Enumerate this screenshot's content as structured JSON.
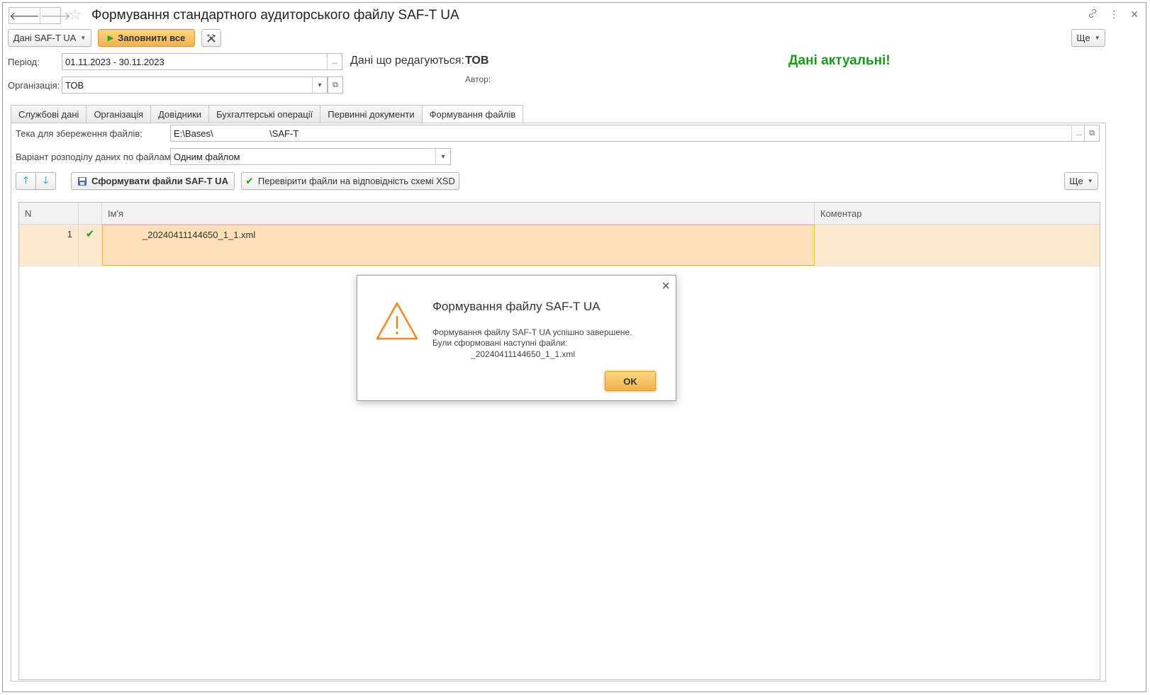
{
  "window": {
    "title": "Формування стандартного аудиторського файлу SAF-T UA",
    "nav": {
      "back": "🡐",
      "forward": "🡒"
    },
    "icons": {
      "link": "link-icon",
      "menu": "more-vertical-icon",
      "close": "close-icon"
    }
  },
  "toolbar": {
    "data_menu": "Дані SAF-T UA",
    "fill_all": "Заповнити все",
    "more": "Ще"
  },
  "header": {
    "period_label": "Період:",
    "period_value": "01.11.2023 - 30.11.2023",
    "period_btn": "...",
    "org_label": "Організація:",
    "org_value": "ТОВ",
    "edited_label": "Дані що редагуються:",
    "edited_value": "ТОВ",
    "author_label": "Автор:",
    "status": "Дані актуальні!",
    "status_color": "#1a9a1a"
  },
  "tabs": [
    "Службові дані",
    "Організація",
    "Довідники",
    "Бухгалтерські операції",
    "Первинні документи",
    "Формування файлів"
  ],
  "files_tab": {
    "folder_label": "Тека для збереження файлів:",
    "folder_value": "E:\\Bases\\                      \\SAF-T",
    "folder_btn": "...",
    "split_label": "Варіант розподілу даних по файлам:",
    "split_value": "Одним файлом",
    "generate_btn": "Сформувати файли SAF-T UA",
    "validate_btn": "Перевірити файли на відповідність схемі XSD",
    "more": "Ще"
  },
  "table": {
    "columns": [
      "N",
      "",
      "Ім'я",
      "Коментар"
    ],
    "rows": [
      {
        "n": "1",
        "status": "✔",
        "name": "_20240411144650_1_1.xml",
        "comment": ""
      }
    ]
  },
  "dialog": {
    "title": "Формування файлу SAF-T UA",
    "line1": "Формування файлу SAF-T UA успішно завершене.",
    "line2": "Були сформовані наступні файли:",
    "line3": "_20240411144650_1_1.xml",
    "ok": "OK",
    "close": "×"
  }
}
